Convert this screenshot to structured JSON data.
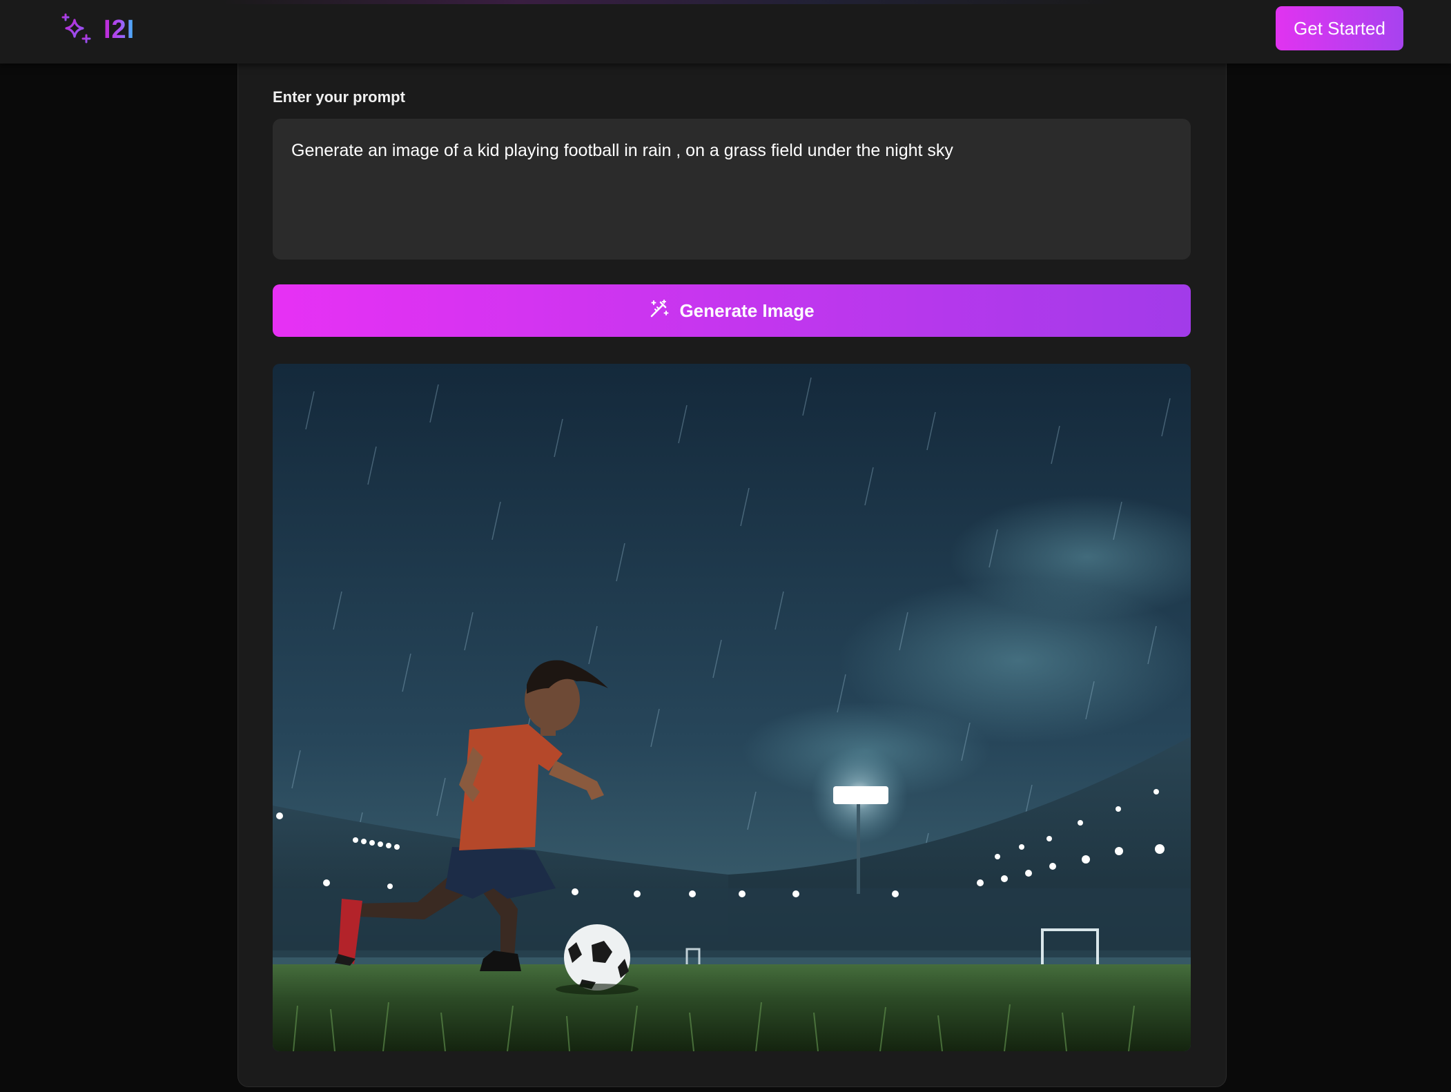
{
  "header": {
    "logo_text": "I2I",
    "logo_icon": "sparkles-icon",
    "cta_label": "Get Started"
  },
  "prompt": {
    "label": "Enter your prompt",
    "value": "Generate an image of a kid playing football in rain , on a grass field under the night sky"
  },
  "generate": {
    "label": "Generate Image",
    "icon": "magic-wand-icon"
  },
  "colors": {
    "accent_start": "#e731f4",
    "accent_end": "#a23be9",
    "card_bg": "#1b1b1b",
    "input_bg": "#2b2b2b",
    "header_bg": "#1a1a1a",
    "page_bg": "#0a0a0a"
  }
}
